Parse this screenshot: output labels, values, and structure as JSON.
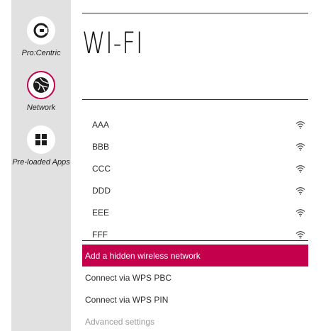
{
  "sidebar": {
    "items": [
      {
        "label": "Pro:Centric",
        "icon": "procentric-icon",
        "selected": false
      },
      {
        "label": "Network",
        "icon": "network-globe-icon",
        "selected": true
      },
      {
        "label": "Pre-loaded Apps",
        "icon": "apps-grid-icon",
        "selected": false
      }
    ]
  },
  "page": {
    "title": "WI-FI"
  },
  "networks": [
    {
      "name": "AAA",
      "icon": "wifi-signal-icon"
    },
    {
      "name": "BBB",
      "icon": "wifi-signal-icon"
    },
    {
      "name": "CCC",
      "icon": "wifi-signal-icon"
    },
    {
      "name": "DDD",
      "icon": "wifi-signal-icon"
    },
    {
      "name": "EEE",
      "icon": "wifi-signal-icon"
    },
    {
      "name": "FFF",
      "icon": "wifi-signal-icon"
    }
  ],
  "menu": {
    "add_hidden": "Add a hidden wireless network",
    "wps_pbc": "Connect via WPS PBC",
    "wps_pin": "Connect via WPS PIN",
    "advanced": "Advanced settings"
  },
  "colors": {
    "accent": "#c4004d",
    "sidebar_bg": "#e1e1e1",
    "disabled_text": "#9a9a9a"
  }
}
